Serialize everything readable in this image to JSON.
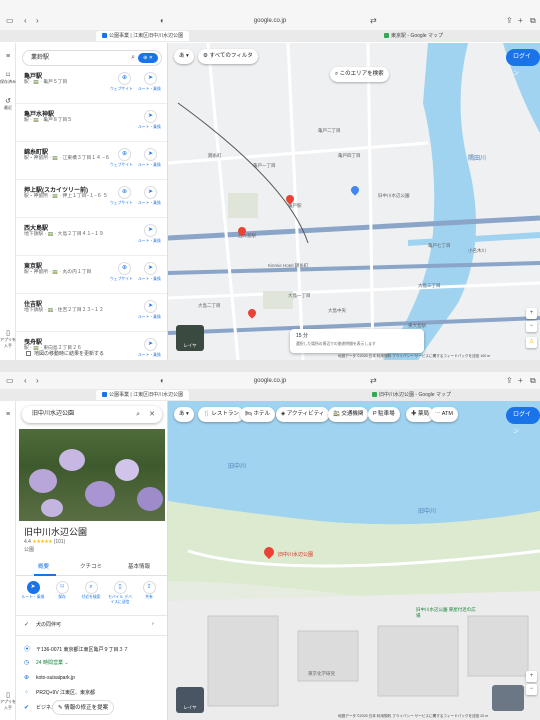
{
  "browser": {
    "url": "google.co.jp",
    "tab_active": "公園事業 | 江東区旧中川水辺公園",
    "tab_right": "東京駅 - Google マップ",
    "tab_active_2": "公園事業 | 江東区旧中川水辺公園",
    "tab_right_2": "旧中川水辺公園 - Google マップ"
  },
  "rail": {
    "saved": "保存済み",
    "recent": "最近",
    "app": "アプリを入手"
  },
  "panel1": {
    "search_query": "業鈴駅",
    "filter_all": "すべてのフィルタ",
    "search_area": "このエリアを検索",
    "login": "ログイン",
    "layer": "レイヤ",
    "transit_time": "15 分",
    "transit_hint": "選択した場所の周辺での旅途時間を表示します",
    "map_footer": "地図データ ©2025 日本 利用規約 プライバシー サービスに関するフィードバックを送信 100 m",
    "footer_checkbox": "地図の移動時に結果を更新する",
    "btn_website": "ウェブサイト",
    "btn_route": "ルート・乗換",
    "results": [
      {
        "name": "亀戸駅",
        "addr": "駅 · 🚃 · 亀戸５丁目"
      },
      {
        "name": "亀戸水神駅",
        "addr": "駅 · 🚃 · 亀戸８丁目５"
      },
      {
        "name": "錦糸町駅",
        "addr": "駅・神留所 · 🚃 · 江東橋３丁目１４ −６"
      },
      {
        "name": "押上駅(スカイツリー前)",
        "addr": "駅・神留所 · 🚃 · 押上１丁目−１−６ ５"
      },
      {
        "name": "西大島駅",
        "addr": "地下鉄駅 · 🚃 · 大島２丁目４１−１９"
      },
      {
        "name": "東京駅",
        "addr": "駅・神留所 · 🚃 · 丸の内１丁目"
      },
      {
        "name": "住吉駅",
        "addr": "地下鉄駅 · 🚃 · 住吉２丁目２３−１２"
      },
      {
        "name": "曳舟駅",
        "addr": "駅 · 🚃 · 東向島２丁目２６"
      }
    ],
    "map_labels": {
      "l01": "隅田川",
      "l02": "旧中川水辺公園",
      "l03": "亀戸駅",
      "l04": "東大島駅",
      "l05": "錦糸町",
      "l06": "大島二丁目",
      "l07": "亀戸二丁目",
      "l08": "Kinmie Hotel 錦糸町",
      "l09": "西大島駅",
      "l10": "大島一丁目",
      "l11": "大島中央",
      "l12": "大島三丁目",
      "l13": "亀戸四丁目",
      "l14": "亀戸七丁目",
      "l15": "小名木川",
      "l16": "亀戸一丁目"
    }
  },
  "panel2": {
    "search_query": "旧中川水辺公園",
    "chips": [
      "レストラン",
      "ホテル",
      "アクティビティ",
      "交通機関",
      "駐車場",
      "薬局",
      "ATM"
    ],
    "login": "ログイン",
    "place_title": "旧中川水辺公園",
    "rating": "4.4",
    "stars": "★★★★★",
    "review_count": "(101)",
    "category": "公園",
    "tabs": [
      "概要",
      "クチコミ",
      "基本情報"
    ],
    "actions": [
      "ルート・乗換",
      "保存",
      "付近を検索",
      "モバイル デバイスに送信",
      "共有"
    ],
    "dog": "犬の同伴可",
    "address": "〒136-0071 東京都江東区亀戸９丁目３７",
    "hours": "24 時間営業",
    "website": "koto-suisaipark.jp",
    "plus_code": "PR2Q+9V 江東区、東京都",
    "owner": "ビジネス オーナーですか？",
    "edit": "情報の修正を提案",
    "layer": "レイヤ",
    "map_labels": {
      "river1": "旧中川",
      "river2": "旧中川",
      "pin": "旧中川水辺公園",
      "park": "旧中川水辺公園 東屋付近の広場",
      "bldg": "東京化学研究"
    },
    "map_footer": "地図データ ©2025 日本 利用規約 プライバシー サービスに関するフィードバックを送信 20 m"
  }
}
